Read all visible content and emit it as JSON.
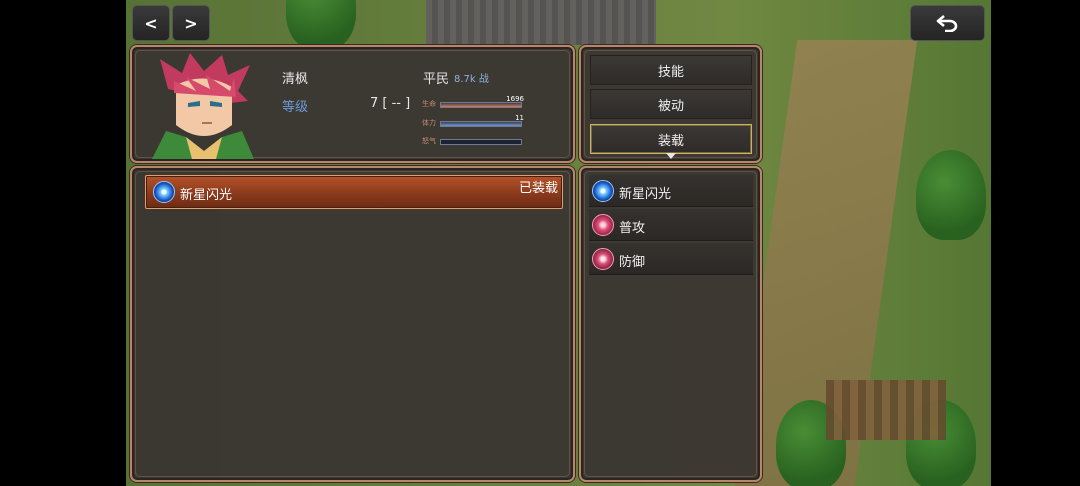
{
  "nav": {
    "prev_symbol": "<",
    "next_symbol": ">",
    "back_icon": "return-arrow-icon"
  },
  "character": {
    "name": "清枫",
    "title": "平民",
    "power": "8.7k 战",
    "level_label": "等级",
    "level_value": "7 [ -- ]",
    "stats": [
      {
        "label": "生命",
        "value": "1696",
        "fill": 1.0,
        "color": "#e07a50"
      },
      {
        "label": "体力",
        "value": "11",
        "fill": 1.0,
        "color": "#6f9ad6"
      },
      {
        "label": "怒气",
        "value": "",
        "fill": 0.0,
        "color": "#6f9ad6"
      }
    ]
  },
  "menu": {
    "skills": "技能",
    "passive": "被动",
    "equip": "装载"
  },
  "equipped": {
    "skill_name": "新星闪光",
    "status": "已装载"
  },
  "skill_list": [
    {
      "name": "新星闪光",
      "icon": "nova-flash-icon"
    },
    {
      "name": "普攻",
      "icon": "basic-attack-icon"
    },
    {
      "name": "防御",
      "icon": "defend-icon"
    }
  ],
  "colors": {
    "panel_border": "#b8866a",
    "equipped_bg": "#a5482a",
    "active_border": "#c9b36a"
  }
}
